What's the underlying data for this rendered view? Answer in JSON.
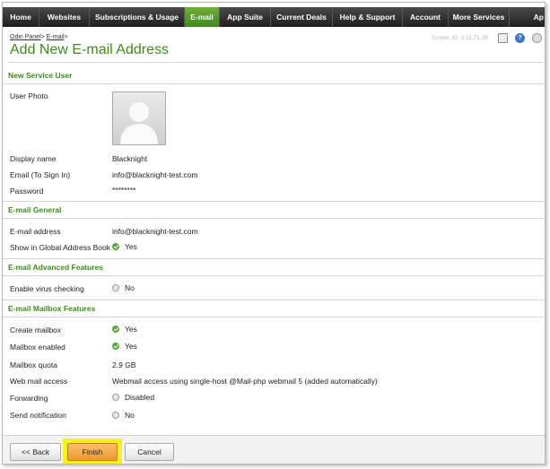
{
  "nav": {
    "tabs": [
      {
        "label": "Home",
        "width": 41
      },
      {
        "label": "Websites",
        "width": 56
      },
      {
        "label": "Subscriptions & Usage",
        "width": 106
      },
      {
        "label": "E-mail",
        "width": 39,
        "active": true
      },
      {
        "label": "App Suite",
        "width": 57
      },
      {
        "label": "Current Deals",
        "width": 69
      },
      {
        "label": "Help & Support",
        "width": 78
      },
      {
        "label": "Account",
        "width": 51
      },
      {
        "label": "More Services",
        "width": 68
      },
      {
        "label": "Ap",
        "width": 41
      }
    ]
  },
  "breadcrumb": {
    "item1": "Odin Panel",
    "sep1": ">",
    "item2": "E-mail",
    "sep2": ">"
  },
  "page_title": "Add New E-mail Address",
  "screen_id": "Screen ID: 3.11.71.28",
  "sections": {
    "service_user": "New Service User",
    "general": "E-mail General",
    "advanced": "E-mail Advanced Features",
    "mailbox": "E-mail Mailbox Features"
  },
  "fields": {
    "user_photo": {
      "label": "User Photo"
    },
    "display_name": {
      "label": "Display name",
      "value": "Blacknight"
    },
    "email_sign_in": {
      "label": "Email (To Sign In)",
      "value": "info@blacknight-test.com"
    },
    "password": {
      "label": "Password",
      "value": "********"
    },
    "email_address": {
      "label": "E-mail address",
      "value": "info@blacknight-test.com"
    },
    "global_address_book": {
      "label": "Show in Global Address Book",
      "value": "Yes"
    },
    "virus_checking": {
      "label": "Enable virus checking",
      "value": "No"
    },
    "create_mailbox": {
      "label": "Create mailbox",
      "value": "Yes"
    },
    "mailbox_enabled": {
      "label": "Mailbox enabled",
      "value": "Yes"
    },
    "mailbox_quota": {
      "label": "Mailbox quota",
      "value": "2.9 GB"
    },
    "web_mail_access": {
      "label": "Web mail access",
      "value": "Webmail access using single-host @Mail-php webmail 5 (added automatically)"
    },
    "forwarding": {
      "label": "Forwarding",
      "value": "Disabled"
    },
    "send_notification": {
      "label": "Send notification",
      "value": "No"
    }
  },
  "buttons": {
    "back": "<< Back",
    "finish": "Finish",
    "cancel": "Cancel"
  },
  "colors": {
    "accent": "#3e8a1c",
    "nav_bg": "#2b2b2b",
    "finish_bg": "#f2a33a",
    "highlight": "#f7ef2a"
  }
}
